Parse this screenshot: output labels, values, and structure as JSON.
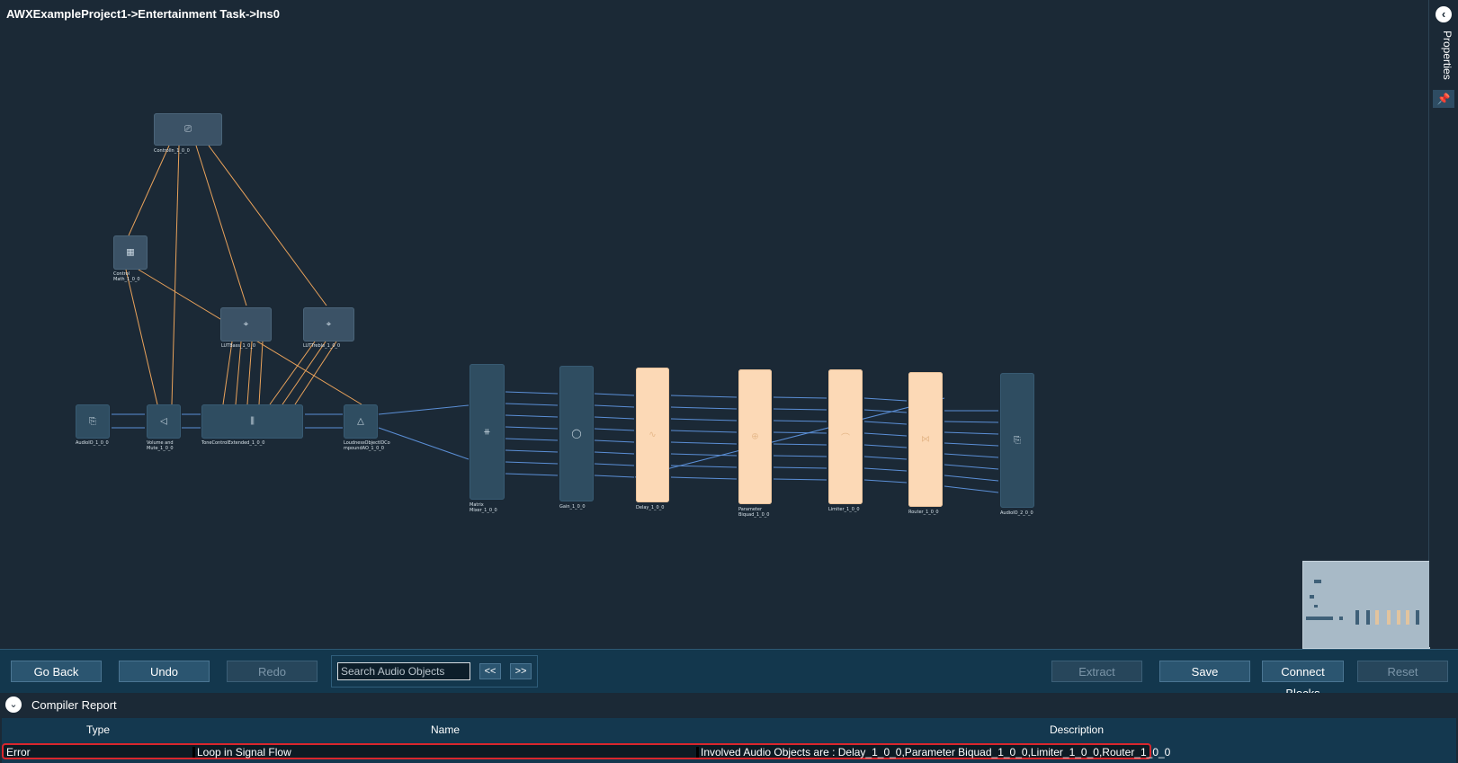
{
  "breadcrumb": "AWXExampleProject1->Entertainment Task->Ins0",
  "properties_panel": {
    "label": "Properties",
    "toggle_icon": "chevron-left-icon",
    "pin_icon": "pin-icon"
  },
  "blocks": {
    "control_in": "ControlIn_1_0_0",
    "control_math": "Control\nMath_1_0_0",
    "lut_bass": "LUTBass_1_0_0",
    "lut_treble": "LUTTreble_1_0_0",
    "audio_io_in": "AudioIO_1_0_0",
    "volume_mute": "Volume and\nMute_1_0_0",
    "tone_control": "ToneControlExtended_1_0_0",
    "loudness": "LoudnessObjectIDCo\nmpoundAO_1_0_0",
    "matrix_mixer": "Matrix\nMixer_1_0_0",
    "gain": "Gain_1_0_0",
    "delay": "Delay_1_0_0",
    "param_biquad": "Parameter\nBiquad_1_0_0",
    "limiter": "Limiter_1_0_0",
    "router": "Router_1_0_0",
    "audio_io_out": "AudioIO_2_0_0"
  },
  "toolbar": {
    "go_back": "Go Back",
    "undo": "Undo",
    "redo": "Redo",
    "search_placeholder": "Search Audio Objects",
    "prev": "<<",
    "next": ">>",
    "extract": "Extract",
    "save": "Save",
    "connect_blocks": "Connect Blocks",
    "reset": "Reset"
  },
  "compiler_report": {
    "title": "Compiler Report",
    "columns": {
      "type": "Type",
      "name": "Name",
      "description": "Description"
    },
    "rows": [
      {
        "type": "Error",
        "name": "Loop in Signal Flow",
        "description": "Involved Audio Objects are : Delay_1_0_0,Parameter Biquad_1_0_0,Limiter_1_0_0,Router_1_0_0"
      }
    ]
  },
  "colors": {
    "canvas_bg": "#1b2936",
    "block": "#2f4d61",
    "loop_block": "#fcd9b6",
    "audio_wire": "#5b8fd6",
    "control_wire": "#e9a25b",
    "error_outline": "#d9262d"
  }
}
